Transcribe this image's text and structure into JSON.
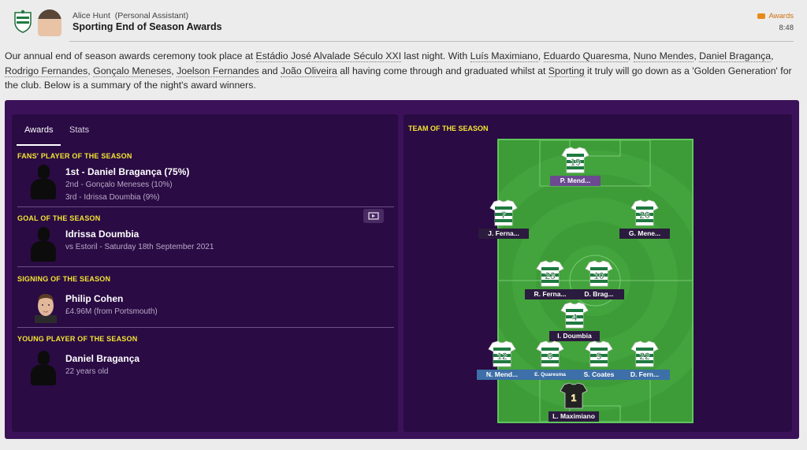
{
  "header": {
    "sender_name": "Alice Hunt",
    "sender_role": "(Personal Assistant)",
    "subject": "Sporting End of Season Awards",
    "tag": "Awards",
    "time": "8:48"
  },
  "intro": {
    "t1": "Our annual end of season awards ceremony took place at ",
    "stadium": "Estádio José Alvalade Século XXI",
    "t2": " last night. With ",
    "p1": "Luís Maximiano",
    "s1": ", ",
    "p2": "Eduardo Quaresma",
    "s2": ", ",
    "p3": "Nuno Mendes",
    "s3": ", ",
    "p4": "Daniel Bragança",
    "s4": ", ",
    "p5": "Rodrigo Fernandes",
    "s5": ", ",
    "p6": "Gonçalo Meneses",
    "s6": ", ",
    "p7": "Joelson Fernandes",
    "s7": " and ",
    "p8": "João Oliveira",
    "t3": " all having come through and graduated whilst at ",
    "club": "Sporting",
    "t4": " it truly will go down as a 'Golden Generation' for the club. Below is a summary of the night's award winners."
  },
  "tabs": [
    "Awards",
    "Stats"
  ],
  "awards": {
    "fans": {
      "title": "FANS' PLAYER OF THE SEASON",
      "first": "1st - Daniel Bragança (75%)",
      "second": "2nd - Gonçalo Meneses (10%)",
      "third": "3rd - Idrissa Doumbia (9%)"
    },
    "goal": {
      "title": "GOAL OF THE SEASON",
      "player": "Idrissa Doumbia",
      "detail": "vs Estoril - Saturday 18th September 2021"
    },
    "signing": {
      "title": "SIGNING OF THE SEASON",
      "player": "Philip Cohen",
      "detail": "£4.96M (from Portsmouth)"
    },
    "young": {
      "title": "YOUNG PLAYER OF THE SEASON",
      "player": "Daniel Bragança",
      "detail": "22 years old"
    }
  },
  "team_of_season": {
    "title": "TEAM OF THE SEASON",
    "players": [
      {
        "number": "19",
        "name": "P. Mend..."
      },
      {
        "number": "7",
        "name": "J. Ferna..."
      },
      {
        "number": "26",
        "name": "G. Mene..."
      },
      {
        "number": "23",
        "name": "R. Ferna..."
      },
      {
        "number": "10",
        "name": "D. Brag..."
      },
      {
        "number": "4",
        "name": "I. Doumbia"
      },
      {
        "number": "12",
        "name": "N. Mend..."
      },
      {
        "number": "6",
        "name": "E. Quaresma"
      },
      {
        "number": "5",
        "name": "S. Coates"
      },
      {
        "number": "22",
        "name": "D. Fern..."
      },
      {
        "number": "1",
        "name": "L. Maximiano"
      }
    ]
  },
  "colors": {
    "panel_bg": "#2a0b44",
    "outer_bg": "#3b1259",
    "accent_yellow": "#f4e533",
    "pitch_green": "#3e9c38"
  }
}
